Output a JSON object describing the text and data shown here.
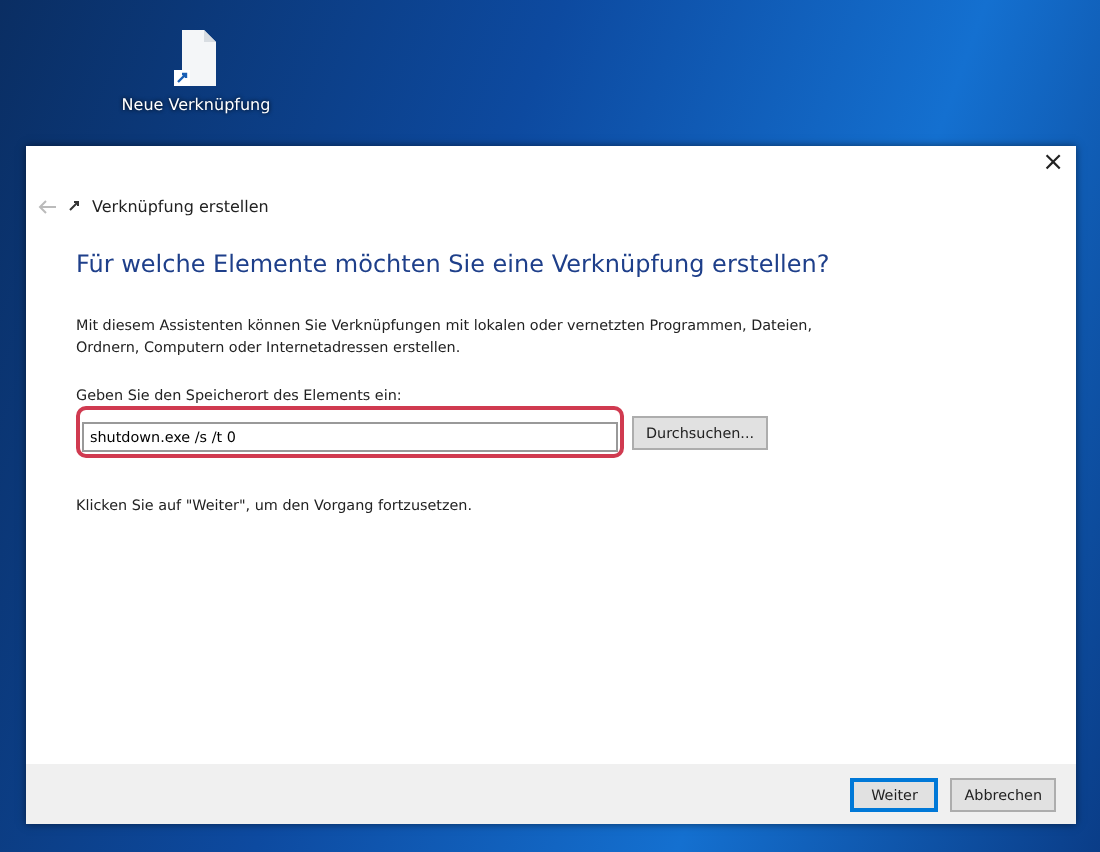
{
  "desktop": {
    "icon_label": "Neue Verknüpfung"
  },
  "window": {
    "close": "×",
    "title": "Verknüpfung erstellen",
    "heading": "Für welche Elemente möchten Sie eine Verknüpfung erstellen?",
    "description": "Mit diesem Assistenten können Sie Verknüpfungen mit lokalen oder vernetzten Programmen, Dateien, Ordnern, Computern oder Internetadressen erstellen.",
    "location_label": "Geben Sie den Speicherort des Elements ein:",
    "location_value": "shutdown.exe /s /t 0",
    "browse_button": "Durchsuchen...",
    "hint": "Klicken Sie auf \"Weiter\", um den Vorgang fortzusetzen.",
    "buttons": [
      {
        "label": "Weiter",
        "selected": true
      },
      {
        "label": "Abbrechen",
        "selected": false
      }
    ]
  }
}
